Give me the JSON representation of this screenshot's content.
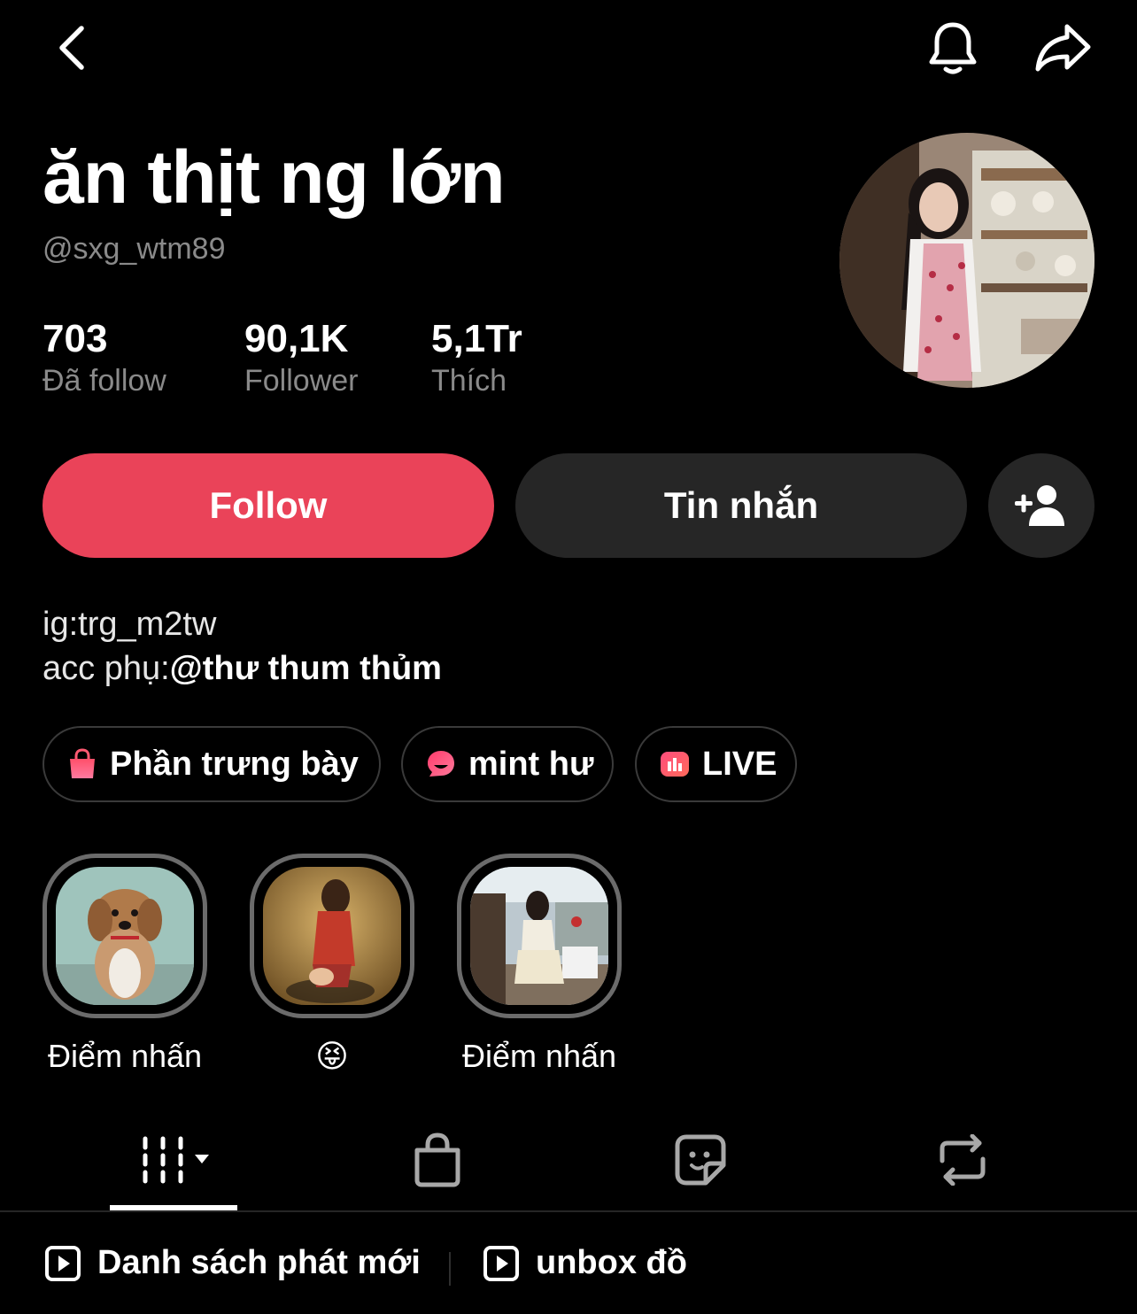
{
  "header": {
    "back_icon": "chevron-left-icon",
    "notification_icon": "bell-icon",
    "share_icon": "share-arrow-icon"
  },
  "profile": {
    "display_name": "ăn thịt ng lớn",
    "username": "@sxg_wtm89",
    "stats": [
      {
        "value": "703",
        "label": "Đã follow"
      },
      {
        "value": "90,1K",
        "label": "Follower"
      },
      {
        "value": "5,1Tr",
        "label": "Thích"
      }
    ]
  },
  "actions": {
    "follow_label": "Follow",
    "message_label": "Tin nhắn",
    "add_friend_icon": "add-user-icon"
  },
  "bio": {
    "line1": "ig:trg_m2tw",
    "line2_prefix": "acc phụ:",
    "line2_mention": "@thư thum thủm"
  },
  "chips": [
    {
      "label": "Phần trưng bày",
      "icon": "shopping-bag-icon"
    },
    {
      "label": "mint hư",
      "icon": "chat-bubble-icon"
    },
    {
      "label": "LIVE",
      "icon": "live-icon"
    }
  ],
  "highlights": [
    {
      "caption": "Điểm nhấn"
    },
    {
      "caption": "😝"
    },
    {
      "caption": "Điểm nhấn"
    }
  ],
  "tabs": [
    {
      "name": "videos-grid",
      "icon": "grid-icon",
      "active": true
    },
    {
      "name": "shop",
      "icon": "shopping-bag-icon",
      "active": false
    },
    {
      "name": "stickers",
      "icon": "sticker-icon",
      "active": false
    },
    {
      "name": "reposts",
      "icon": "repost-icon",
      "active": false
    }
  ],
  "playlists": [
    {
      "label": "Danh sách phát mới",
      "icon": "play-icon"
    },
    {
      "label": "unbox đồ",
      "icon": "play-icon"
    }
  ],
  "colors": {
    "background": "#000000",
    "follow_button": "#ea4359",
    "secondary_button": "#262626",
    "muted_text": "#8a8a8a"
  }
}
